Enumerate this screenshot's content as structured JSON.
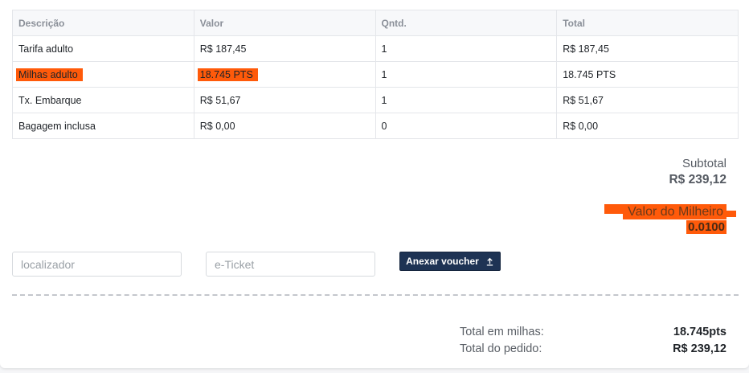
{
  "table": {
    "headers": [
      "Descrição",
      "Valor",
      "Qntd.",
      "Total"
    ],
    "rows": [
      {
        "descricao": "Tarifa adulto",
        "valor": "R$ 187,45",
        "qntd": "1",
        "total": "R$ 187,45"
      },
      {
        "descricao": "Milhas adulto",
        "valor": "18.745 PTS",
        "qntd": "1",
        "total": "18.745 PTS"
      },
      {
        "descricao": "Tx. Embarque",
        "valor": "R$ 51,67",
        "qntd": "1",
        "total": "R$ 51,67"
      },
      {
        "descricao": "Bagagem inclusa",
        "valor": "R$ 0,00",
        "qntd": "0",
        "total": "R$ 0,00"
      }
    ]
  },
  "subtotal": {
    "label": "Subtotal",
    "value": "R$ 239,12"
  },
  "milheiro": {
    "label": "Valor do Milheiro",
    "value": "0.0100"
  },
  "form": {
    "localizador_placeholder": "localizador",
    "localizador_value": "",
    "eticket_placeholder": "e-Ticket",
    "eticket_value": "",
    "voucher_button": "Anexar voucher",
    "voucher_icon": "upload-icon"
  },
  "totals": {
    "milhas_label": "Total em milhas:",
    "milhas_value": "18.745pts",
    "pedido_label": "Total do pedido:",
    "pedido_value": "R$ 239,12"
  },
  "colors": {
    "highlight": "#ff5a0a",
    "button_bg": "#1e3354"
  }
}
